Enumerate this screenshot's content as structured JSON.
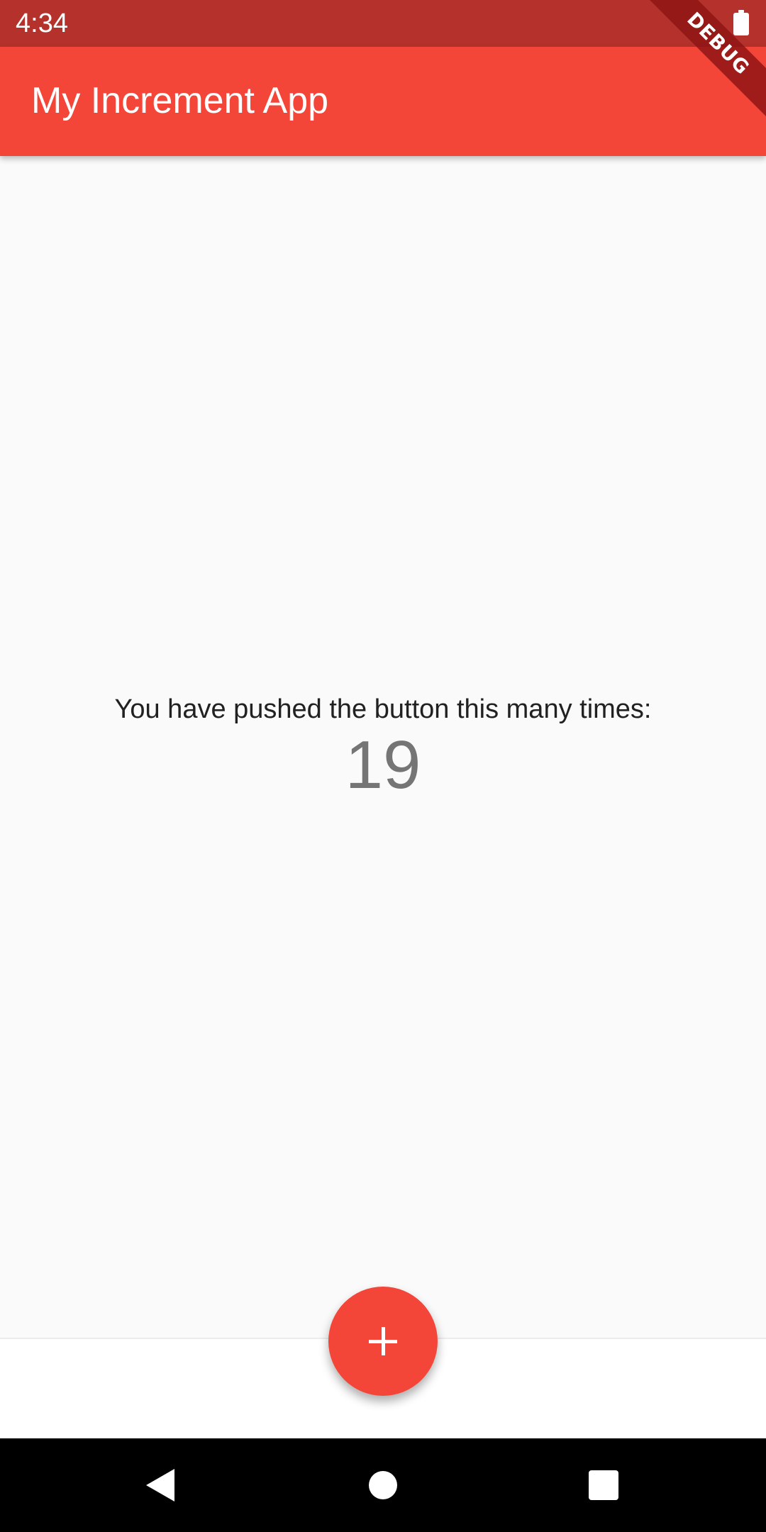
{
  "status_bar": {
    "time": "4:34",
    "battery_icon": "battery-full-icon"
  },
  "app_bar": {
    "title": "My Increment App"
  },
  "debug_banner": {
    "label": "DEBUG"
  },
  "counter": {
    "label": "You have pushed the button this many times:",
    "value": "19"
  },
  "fab": {
    "icon": "plus-icon"
  },
  "nav_bar": {
    "back_icon": "back-triangle-icon",
    "home_icon": "home-circle-icon",
    "recents_icon": "recents-square-icon"
  },
  "colors": {
    "primary": "#f44539",
    "status_bar": "#b4322b",
    "background": "#fafafa",
    "counter_text": "#757575",
    "label_text": "#212121"
  }
}
